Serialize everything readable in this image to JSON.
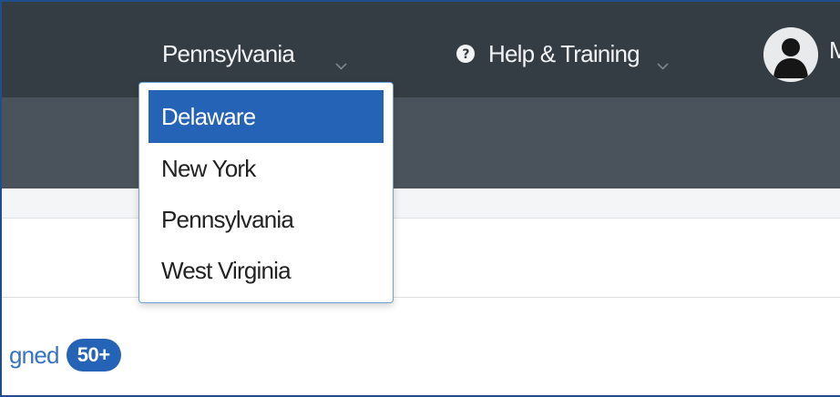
{
  "header": {
    "state_selector": {
      "label": "Pennsylvania",
      "icon": "chevron-down-icon"
    },
    "help_menu": {
      "label": "Help & Training",
      "icon": "question-circle-icon",
      "chevron": "chevron-down-icon"
    },
    "user_menu": {
      "avatar_icon": "user-avatar-icon",
      "name_partial": "M"
    }
  },
  "state_dropdown": {
    "options": [
      {
        "label": "Delaware",
        "selected": true
      },
      {
        "label": "New York",
        "selected": false
      },
      {
        "label": "Pennsylvania",
        "selected": false
      },
      {
        "label": "West Virginia",
        "selected": false
      }
    ]
  },
  "main": {
    "assigned_link": {
      "label": "gned",
      "badge": "50+"
    }
  },
  "colors": {
    "top_nav_bg": "#353d44",
    "sub_nav_bg": "#4a535b",
    "selected_option_bg": "#2563b6",
    "link_color": "#3773c2",
    "badge_bg": "#2563b6"
  }
}
